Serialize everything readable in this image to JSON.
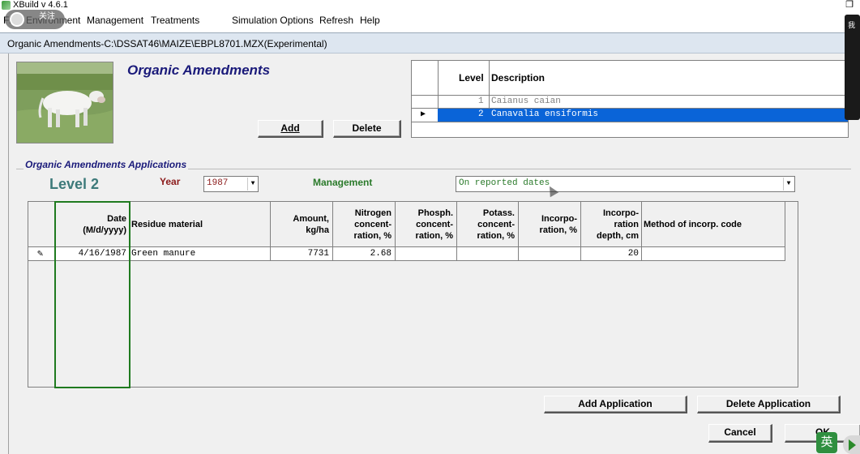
{
  "app": {
    "title": "XBuild v 4.6.1",
    "restore_glyph": "❐"
  },
  "menu": {
    "items": [
      "File",
      "Environment",
      "Management",
      "Treatments",
      "Simulation Options",
      "Refresh",
      "Help"
    ],
    "overlay_text": "关注"
  },
  "dialog": {
    "title": "Organic Amendments-C:\\DSSAT46\\MAIZE\\EBPL8701.MZX(Experimental)",
    "heading": "Organic Amendments",
    "add_label": "Add",
    "delete_label": "Delete"
  },
  "levels": {
    "headers": {
      "level": "Level",
      "description": "Description"
    },
    "rows": [
      {
        "level": "1",
        "description": "Caianus caian",
        "selected": false
      },
      {
        "level": "2",
        "description": "Canavalia ensiformis",
        "selected": true
      }
    ],
    "selected_color": "#0a64d8",
    "row_pointer_glyph": "▶"
  },
  "applications": {
    "section_title": "Organic Amendments Applications",
    "level_label": "Level 2",
    "year_label": "Year",
    "year_value": "1987",
    "management_label": "Management",
    "management_value": "On reported dates",
    "columns": [
      {
        "key": "date",
        "label": "Date\n(M/d/yyyy)"
      },
      {
        "key": "residue",
        "label": "Residue material"
      },
      {
        "key": "amount",
        "label": "Amount,\nkg/ha"
      },
      {
        "key": "nitrogen",
        "label": "Nitrogen\nconcent-\nration, %"
      },
      {
        "key": "phosph",
        "label": "Phosph.\nconcent-\nration, %"
      },
      {
        "key": "potass",
        "label": "Potass.\nconcent-\nration, %"
      },
      {
        "key": "incorp",
        "label": "Incorpo-\nration, %"
      },
      {
        "key": "depth",
        "label": "Incorpo-\nration\ndepth, cm"
      },
      {
        "key": "method",
        "label": "Method of incorp. code"
      }
    ],
    "rows": [
      {
        "date": "4/16/1987",
        "residue": "Green manure",
        "amount": "7731",
        "nitrogen": "2.68",
        "phosph": "",
        "potass": "",
        "incorp": "",
        "depth": "20",
        "method": ""
      }
    ],
    "row_edit_glyph": "✎",
    "add_application_label": "Add Application",
    "delete_application_label": "Delete Application"
  },
  "footer": {
    "cancel_label": "Cancel",
    "ok_label": "OK"
  },
  "ime": {
    "badge": "英",
    "side_text": "我"
  },
  "colors": {
    "heading_blue": "#1a1a7a",
    "level_teal": "#3d7a7a",
    "year_red": "#8b1a1a",
    "management_green": "#2a7a2a",
    "focus_green": "#1f7a1f"
  }
}
